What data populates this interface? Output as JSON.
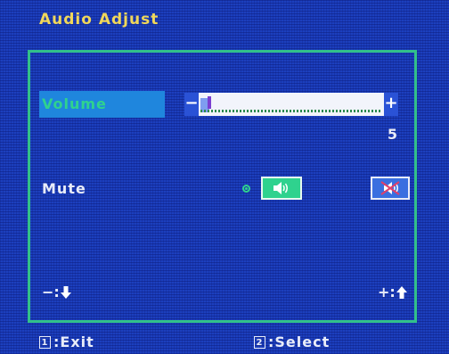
{
  "osd": {
    "title": "Audio Adjust"
  },
  "volume": {
    "label": "Volume",
    "minus_symbol": "−",
    "plus_symbol": "+",
    "value_text": "5",
    "level_fraction": 0.05
  },
  "mute": {
    "label": "Mute",
    "selected": "speaker-on",
    "options": [
      {
        "name": "speaker-on-icon",
        "selected": true
      },
      {
        "name": "speaker-muted-icon",
        "selected": false
      }
    ]
  },
  "navigation": {
    "decrease_label": "−:",
    "increase_label": "+:"
  },
  "footer": {
    "exit_key": "1",
    "exit_label": ":Exit",
    "select_key": "2",
    "select_label": ":Select"
  },
  "colors": {
    "background": "#1c3fbe",
    "title": "#f0d75a",
    "accent": "#2fd28e",
    "highlight": "#1f86dd",
    "text": "#e8ecf8"
  }
}
